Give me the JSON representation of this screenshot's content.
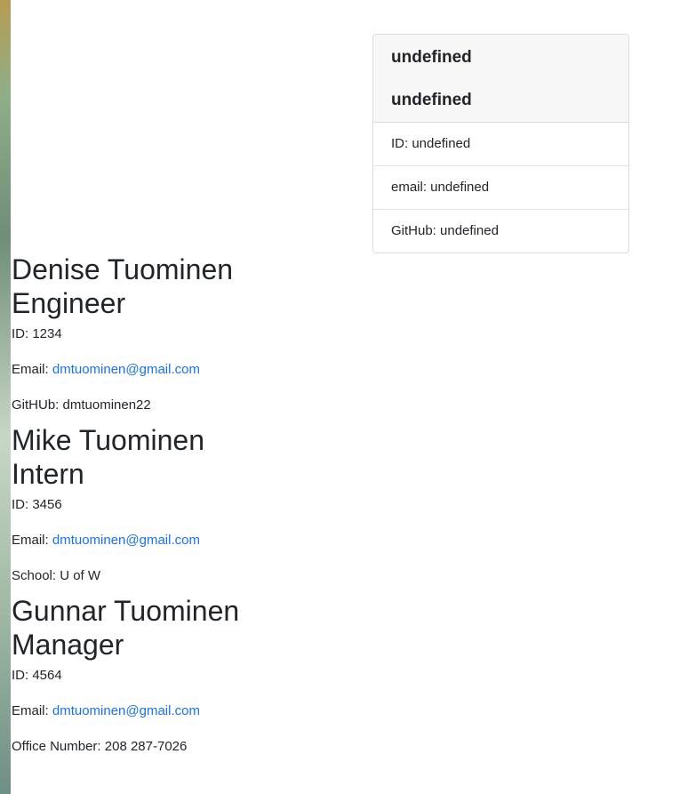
{
  "card": {
    "title": "undefined",
    "subtitle": "undefined",
    "items": [
      {
        "label": "ID: undefined"
      },
      {
        "label": "email: undefined"
      },
      {
        "label": "GitHub: undefined"
      }
    ]
  },
  "employees": [
    {
      "name": "Denise Tuominen",
      "role": "Engineer",
      "id_text": "ID: 1234",
      "email_prefix": "Email:",
      "email": "dmtuominen@gmail.com",
      "extra": "GitHUb: dmtuominen22"
    },
    {
      "name": "Mike Tuominen",
      "role": "Intern",
      "id_text": "ID: 3456",
      "email_prefix": "Email:",
      "email": "dmtuominen@gmail.com",
      "extra": "School: U of W"
    },
    {
      "name": "Gunnar Tuominen",
      "role": "Manager",
      "id_text": "ID: 4564",
      "email_prefix": "Email:",
      "email": "dmtuominen@gmail.com",
      "extra": "Office Number: 208 287-7026"
    }
  ],
  "colors": {
    "link": "#1a73e8",
    "text": "#212529",
    "card_header_bg": "#f7f7f7",
    "border": "#dcdcdc"
  }
}
